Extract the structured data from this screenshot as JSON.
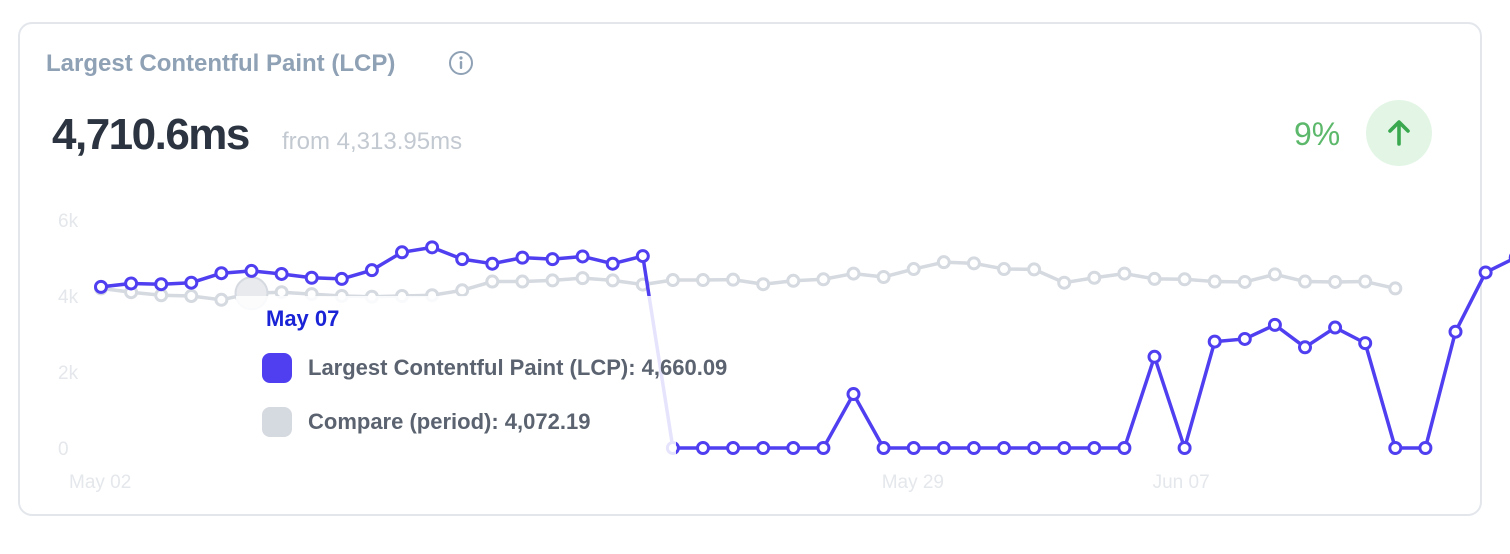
{
  "card": {
    "title": "Largest Contentful Paint (LCP)",
    "info_icon": "info-icon",
    "value": "4,710.6ms",
    "from_text": "from 4,313.95ms",
    "change_percent": "9%",
    "trend_icon": "arrow-up-icon",
    "trend_color": "#5cb86a"
  },
  "tooltip": {
    "date": "May 07",
    "rows": [
      {
        "label": "Largest Contentful Paint (LCP): 4,660.09",
        "color": "#4f3ff0"
      },
      {
        "label": "Compare (period): 4,072.19",
        "color": "#d5d9e0"
      }
    ]
  },
  "chart_data": {
    "type": "line",
    "y_ticks": [
      "6k",
      "4k",
      "2k",
      "0"
    ],
    "ylim": [
      0,
      6000
    ],
    "x_tick_labels": [
      {
        "label": "May 02",
        "index": 0
      },
      {
        "label": "May 29",
        "index": 27
      },
      {
        "label": "Jun 07",
        "index": 36
      }
    ],
    "x_count": 45,
    "highlight_index": 5,
    "series": [
      {
        "name": "Largest Contentful Paint (LCP)",
        "color": "#4f3ff0",
        "values": [
          4240,
          4330,
          4310,
          4350,
          4600,
          4660,
          4580,
          4480,
          4450,
          4680,
          5150,
          5280,
          4970,
          4850,
          5010,
          4970,
          5040,
          4850,
          5050,
          0,
          0,
          0,
          0,
          0,
          0,
          1420,
          0,
          0,
          0,
          0,
          0,
          0,
          0,
          0,
          0,
          2400,
          0,
          2800,
          2870,
          3240,
          2650,
          3170,
          2760,
          0,
          0,
          3060,
          4620,
          5010
        ]
      },
      {
        "name": "Compare (period)",
        "color": "#d5d9e0",
        "values": [
          4200,
          4100,
          4020,
          4000,
          3900,
          4072,
          4100,
          4050,
          4000,
          3980,
          4000,
          4020,
          4150,
          4380,
          4380,
          4410,
          4470,
          4410,
          4300,
          4420,
          4420,
          4430,
          4310,
          4400,
          4440,
          4590,
          4500,
          4710,
          4890,
          4860,
          4710,
          4700,
          4350,
          4480,
          4590,
          4450,
          4440,
          4380,
          4370,
          4570,
          4380,
          4370,
          4380,
          4200
        ]
      }
    ]
  }
}
